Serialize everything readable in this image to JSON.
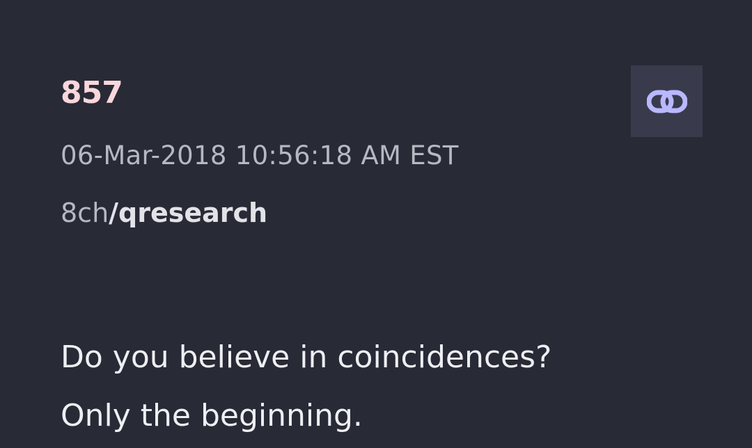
{
  "post": {
    "number": "857",
    "timestamp": "06-Mar-2018 10:56:18 AM EST",
    "board_site": "8ch",
    "board_separator": "/",
    "board_name": "qresearch",
    "link_icon": "link-icon",
    "message_lines": [
      "Do you believe in coincidences?",
      "Only the beginning."
    ]
  },
  "colors": {
    "background": "#282a36",
    "post_number": "#f8d7dc",
    "link_icon": "#b9b8ff",
    "link_button_bg": "#393b4c"
  }
}
